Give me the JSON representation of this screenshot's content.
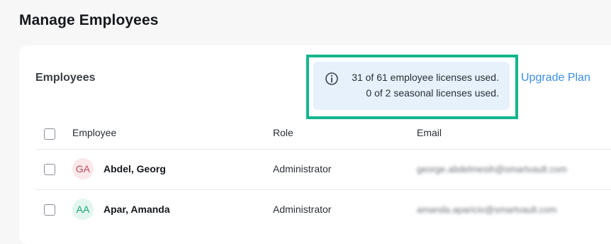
{
  "page": {
    "title": "Manage Employees"
  },
  "section": {
    "title": "Employees"
  },
  "licenses": {
    "employee_line": "31 of 61 employee licenses used.",
    "seasonal_line": "0 of 2 seasonal licenses used.",
    "icon": "info-icon"
  },
  "upgrade": {
    "label": "Upgrade Plan"
  },
  "table": {
    "headers": [
      "Employee",
      "Role",
      "Email"
    ],
    "rows": [
      {
        "initials": "GA",
        "name": "Abdel, Georg",
        "role": "Administrator",
        "email": "george.abdelmesih@smartvault.com",
        "avatar_bg": "#fbe8ea",
        "avatar_fg": "#c0475a"
      },
      {
        "initials": "AA",
        "name": "Apar, Amanda",
        "role": "Administrator",
        "email": "amanda.aparicio@smartvault.com",
        "avatar_bg": "#e2f6ef",
        "avatar_fg": "#1ea37a"
      }
    ]
  },
  "colors": {
    "highlight": "#14b68c",
    "link": "#3a8ee6",
    "info_bg": "#e6f1fb"
  }
}
